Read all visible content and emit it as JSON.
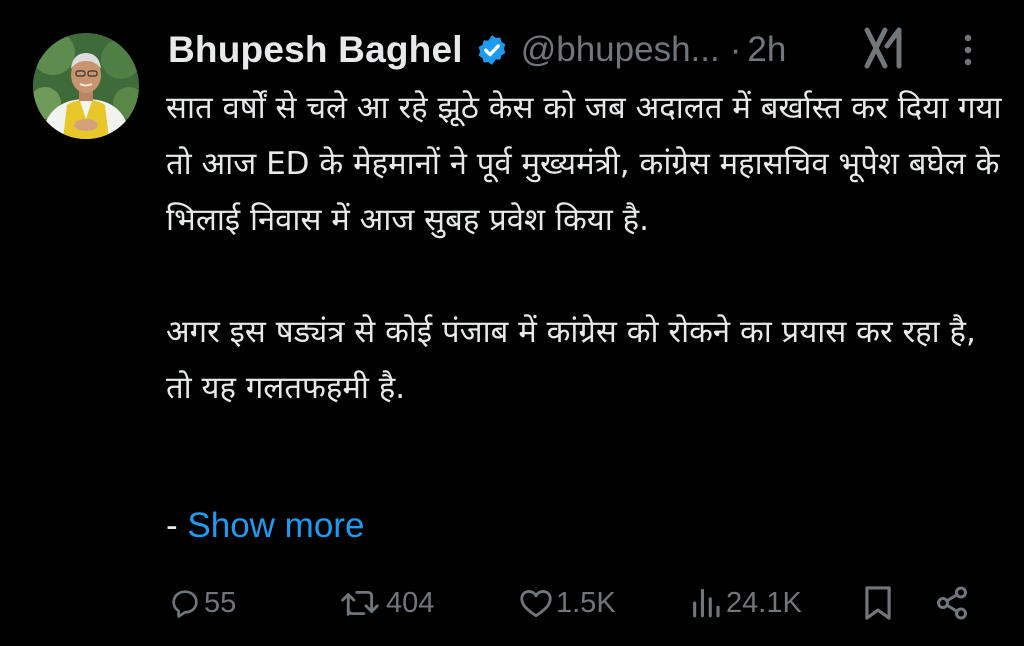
{
  "tweet": {
    "author_name": "Bhupesh Baghel",
    "handle": "@bhupesh...",
    "separator": "·",
    "time": "2h",
    "paragraphs": [
      "सात वर्षों से चले आ रहे झूठे केस को जब अदालत में बर्खास्त कर दिया गया तो आज ED के मेहमानों ने पूर्व मुख्यमंत्री, कांग्रेस महासचिव भूपेश बघेल के भिलाई निवास में आज सुबह प्रवेश किया है.",
      "अगर इस षड्यंत्र से कोई पंजाब में कांग्रेस को रोकने का प्रयास कर रहा है, तो यह गलतफहमी है."
    ],
    "show_more_dash": "-",
    "show_more": "Show more"
  },
  "actions": {
    "replies": "55",
    "reposts": "404",
    "likes": "1.5K",
    "views": "24.1K"
  },
  "icons": {
    "verified": "verified-badge-icon",
    "grok": "grok-icon",
    "more": "more-options-icon",
    "reply": "reply-icon",
    "repost": "repost-icon",
    "like": "like-icon",
    "views": "views-icon",
    "bookmark": "bookmark-icon",
    "share": "share-icon"
  },
  "colors": {
    "background": "#000000",
    "text": "#e7e9ea",
    "secondary": "#71767b",
    "link": "#1d9bf0"
  }
}
